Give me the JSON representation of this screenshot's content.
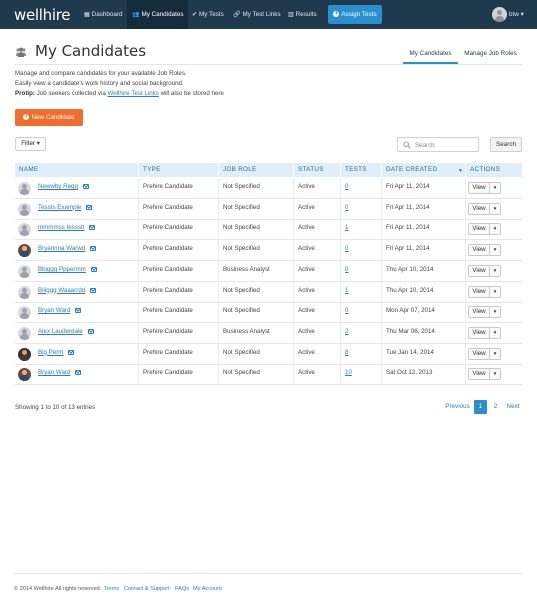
{
  "navbar": {
    "brand": "wellhire",
    "items": [
      {
        "label": "Dashboard",
        "icon": "dashboard-icon",
        "active": false
      },
      {
        "label": "My Candidates",
        "icon": "users-icon",
        "active": true
      },
      {
        "label": "My Tests",
        "icon": "check-icon",
        "active": false
      },
      {
        "label": "My Test Links",
        "icon": "link-icon",
        "active": false
      },
      {
        "label": "Results",
        "icon": "chart-icon",
        "active": false
      }
    ],
    "assign_button": "Assign Tests",
    "user": "btw"
  },
  "header": {
    "title": "My Candidates",
    "tabs": [
      {
        "label": "My Candidates",
        "active": true
      },
      {
        "label": "Manage Job Roles",
        "active": false
      }
    ]
  },
  "description": {
    "line1": "Manage and compare candidates for your available Job Roles.",
    "line2": "Easily view a candidate's work history and social background.",
    "protip_label": "Protip:",
    "protip_pre": " Job seekers collected via ",
    "protip_link": "Wellhire Test Links",
    "protip_post": " will also be stored here"
  },
  "new_candidate_button": "New Candidate",
  "filter_button": "Filter",
  "search": {
    "placeholder": "Search",
    "button": "Search"
  },
  "table": {
    "columns": [
      "Name",
      "Type",
      "Job Role",
      "Status",
      "Tests",
      "Date Created",
      "Actions"
    ],
    "sorted_column": "Date Created",
    "action_label": "View",
    "rows": [
      {
        "name": "Newwby Regg",
        "avatar": "default",
        "type": "Prehire Candidate",
        "job_role": "Not Specified",
        "status": "Active",
        "tests": "0",
        "date": "Fri Apr 11, 2014"
      },
      {
        "name": "Tessts Example",
        "avatar": "default",
        "type": "Prehire Candidate",
        "job_role": "Not Specified",
        "status": "Active",
        "tests": "0",
        "date": "Fri Apr 11, 2014"
      },
      {
        "name": "mmmmss tessstt",
        "avatar": "default",
        "type": "Prehire Candidate",
        "job_role": "Not Specified",
        "status": "Active",
        "tests": "1",
        "date": "Fri Apr 11, 2014"
      },
      {
        "name": "Bryannna Warwd",
        "avatar": "photo",
        "type": "Prehire Candidate",
        "job_role": "Not Specified",
        "status": "Active",
        "tests": "0",
        "date": "Fri Apr 11, 2014"
      },
      {
        "name": "Bbiggg Pppermm",
        "avatar": "default",
        "type": "Prehire Candidate",
        "job_role": "Business Analyst",
        "status": "Active",
        "tests": "0",
        "date": "Thu Apr 10, 2014"
      },
      {
        "name": "Biiiggg Waaarrdd",
        "avatar": "default",
        "type": "Prehire Candidate",
        "job_role": "Not Specified",
        "status": "Active",
        "tests": "1",
        "date": "Thu Apr 10, 2014"
      },
      {
        "name": "Bryan Ward",
        "avatar": "default",
        "type": "Prehire Candidate",
        "job_role": "Not Specified",
        "status": "Active",
        "tests": "0",
        "date": "Mon Apr 07, 2014"
      },
      {
        "name": "Alex Lauderdale",
        "avatar": "default",
        "type": "Prehire Candidate",
        "job_role": "Business Analyst",
        "status": "Active",
        "tests": "2",
        "date": "Thu Mar 06, 2014"
      },
      {
        "name": "Big Perm",
        "avatar": "photo2",
        "type": "Prehire Candidate",
        "job_role": "Not Specified",
        "status": "Active",
        "tests": "8",
        "date": "Tue Jan 14, 2014"
      },
      {
        "name": "Bryan Ward",
        "avatar": "photo",
        "type": "Prehire Candidate",
        "job_role": "Not Specified",
        "status": "Active",
        "tests": "10",
        "date": "Sat Oct 12, 2013"
      }
    ]
  },
  "pagination": {
    "showing": "Showing 1 to 10 of 13 entries",
    "previous": "Previous",
    "pages": [
      "1",
      "2"
    ],
    "current_page": "1",
    "next": "Next"
  },
  "footer": {
    "copyright": "© 2014 Wellhire All rights reserved.",
    "links": [
      "Terms",
      "Contact & Support",
      "FAQs",
      "My Account"
    ]
  },
  "colors": {
    "navbar": "#1f3a4d",
    "accent": "#2a8fcf",
    "new_candidate": "#f06d2b",
    "link": "#2a7fc0",
    "table_header": "#dfeef8"
  }
}
